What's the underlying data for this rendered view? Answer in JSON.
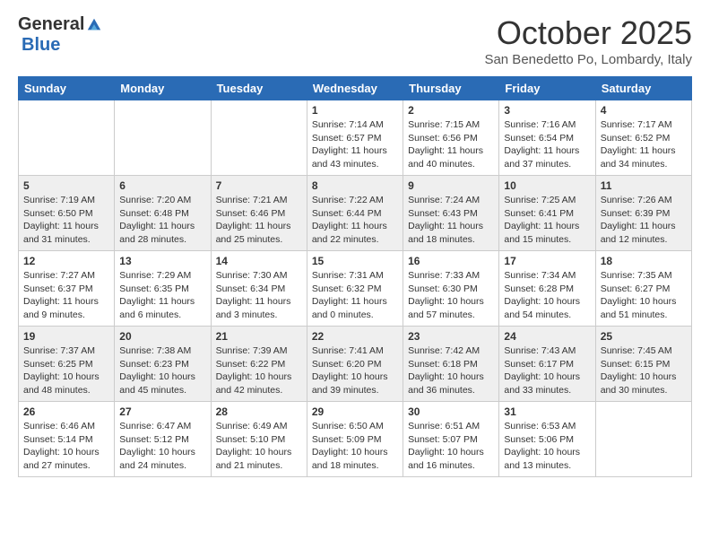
{
  "logo": {
    "general": "General",
    "blue": "Blue"
  },
  "title": "October 2025",
  "location": "San Benedetto Po, Lombardy, Italy",
  "days_of_week": [
    "Sunday",
    "Monday",
    "Tuesday",
    "Wednesday",
    "Thursday",
    "Friday",
    "Saturday"
  ],
  "weeks": [
    [
      {
        "day": "",
        "info": ""
      },
      {
        "day": "",
        "info": ""
      },
      {
        "day": "",
        "info": ""
      },
      {
        "day": "1",
        "info": "Sunrise: 7:14 AM\nSunset: 6:57 PM\nDaylight: 11 hours\nand 43 minutes."
      },
      {
        "day": "2",
        "info": "Sunrise: 7:15 AM\nSunset: 6:56 PM\nDaylight: 11 hours\nand 40 minutes."
      },
      {
        "day": "3",
        "info": "Sunrise: 7:16 AM\nSunset: 6:54 PM\nDaylight: 11 hours\nand 37 minutes."
      },
      {
        "day": "4",
        "info": "Sunrise: 7:17 AM\nSunset: 6:52 PM\nDaylight: 11 hours\nand 34 minutes."
      }
    ],
    [
      {
        "day": "5",
        "info": "Sunrise: 7:19 AM\nSunset: 6:50 PM\nDaylight: 11 hours\nand 31 minutes."
      },
      {
        "day": "6",
        "info": "Sunrise: 7:20 AM\nSunset: 6:48 PM\nDaylight: 11 hours\nand 28 minutes."
      },
      {
        "day": "7",
        "info": "Sunrise: 7:21 AM\nSunset: 6:46 PM\nDaylight: 11 hours\nand 25 minutes."
      },
      {
        "day": "8",
        "info": "Sunrise: 7:22 AM\nSunset: 6:44 PM\nDaylight: 11 hours\nand 22 minutes."
      },
      {
        "day": "9",
        "info": "Sunrise: 7:24 AM\nSunset: 6:43 PM\nDaylight: 11 hours\nand 18 minutes."
      },
      {
        "day": "10",
        "info": "Sunrise: 7:25 AM\nSunset: 6:41 PM\nDaylight: 11 hours\nand 15 minutes."
      },
      {
        "day": "11",
        "info": "Sunrise: 7:26 AM\nSunset: 6:39 PM\nDaylight: 11 hours\nand 12 minutes."
      }
    ],
    [
      {
        "day": "12",
        "info": "Sunrise: 7:27 AM\nSunset: 6:37 PM\nDaylight: 11 hours\nand 9 minutes."
      },
      {
        "day": "13",
        "info": "Sunrise: 7:29 AM\nSunset: 6:35 PM\nDaylight: 11 hours\nand 6 minutes."
      },
      {
        "day": "14",
        "info": "Sunrise: 7:30 AM\nSunset: 6:34 PM\nDaylight: 11 hours\nand 3 minutes."
      },
      {
        "day": "15",
        "info": "Sunrise: 7:31 AM\nSunset: 6:32 PM\nDaylight: 11 hours\nand 0 minutes."
      },
      {
        "day": "16",
        "info": "Sunrise: 7:33 AM\nSunset: 6:30 PM\nDaylight: 10 hours\nand 57 minutes."
      },
      {
        "day": "17",
        "info": "Sunrise: 7:34 AM\nSunset: 6:28 PM\nDaylight: 10 hours\nand 54 minutes."
      },
      {
        "day": "18",
        "info": "Sunrise: 7:35 AM\nSunset: 6:27 PM\nDaylight: 10 hours\nand 51 minutes."
      }
    ],
    [
      {
        "day": "19",
        "info": "Sunrise: 7:37 AM\nSunset: 6:25 PM\nDaylight: 10 hours\nand 48 minutes."
      },
      {
        "day": "20",
        "info": "Sunrise: 7:38 AM\nSunset: 6:23 PM\nDaylight: 10 hours\nand 45 minutes."
      },
      {
        "day": "21",
        "info": "Sunrise: 7:39 AM\nSunset: 6:22 PM\nDaylight: 10 hours\nand 42 minutes."
      },
      {
        "day": "22",
        "info": "Sunrise: 7:41 AM\nSunset: 6:20 PM\nDaylight: 10 hours\nand 39 minutes."
      },
      {
        "day": "23",
        "info": "Sunrise: 7:42 AM\nSunset: 6:18 PM\nDaylight: 10 hours\nand 36 minutes."
      },
      {
        "day": "24",
        "info": "Sunrise: 7:43 AM\nSunset: 6:17 PM\nDaylight: 10 hours\nand 33 minutes."
      },
      {
        "day": "25",
        "info": "Sunrise: 7:45 AM\nSunset: 6:15 PM\nDaylight: 10 hours\nand 30 minutes."
      }
    ],
    [
      {
        "day": "26",
        "info": "Sunrise: 6:46 AM\nSunset: 5:14 PM\nDaylight: 10 hours\nand 27 minutes."
      },
      {
        "day": "27",
        "info": "Sunrise: 6:47 AM\nSunset: 5:12 PM\nDaylight: 10 hours\nand 24 minutes."
      },
      {
        "day": "28",
        "info": "Sunrise: 6:49 AM\nSunset: 5:10 PM\nDaylight: 10 hours\nand 21 minutes."
      },
      {
        "day": "29",
        "info": "Sunrise: 6:50 AM\nSunset: 5:09 PM\nDaylight: 10 hours\nand 18 minutes."
      },
      {
        "day": "30",
        "info": "Sunrise: 6:51 AM\nSunset: 5:07 PM\nDaylight: 10 hours\nand 16 minutes."
      },
      {
        "day": "31",
        "info": "Sunrise: 6:53 AM\nSunset: 5:06 PM\nDaylight: 10 hours\nand 13 minutes."
      },
      {
        "day": "",
        "info": ""
      }
    ]
  ]
}
